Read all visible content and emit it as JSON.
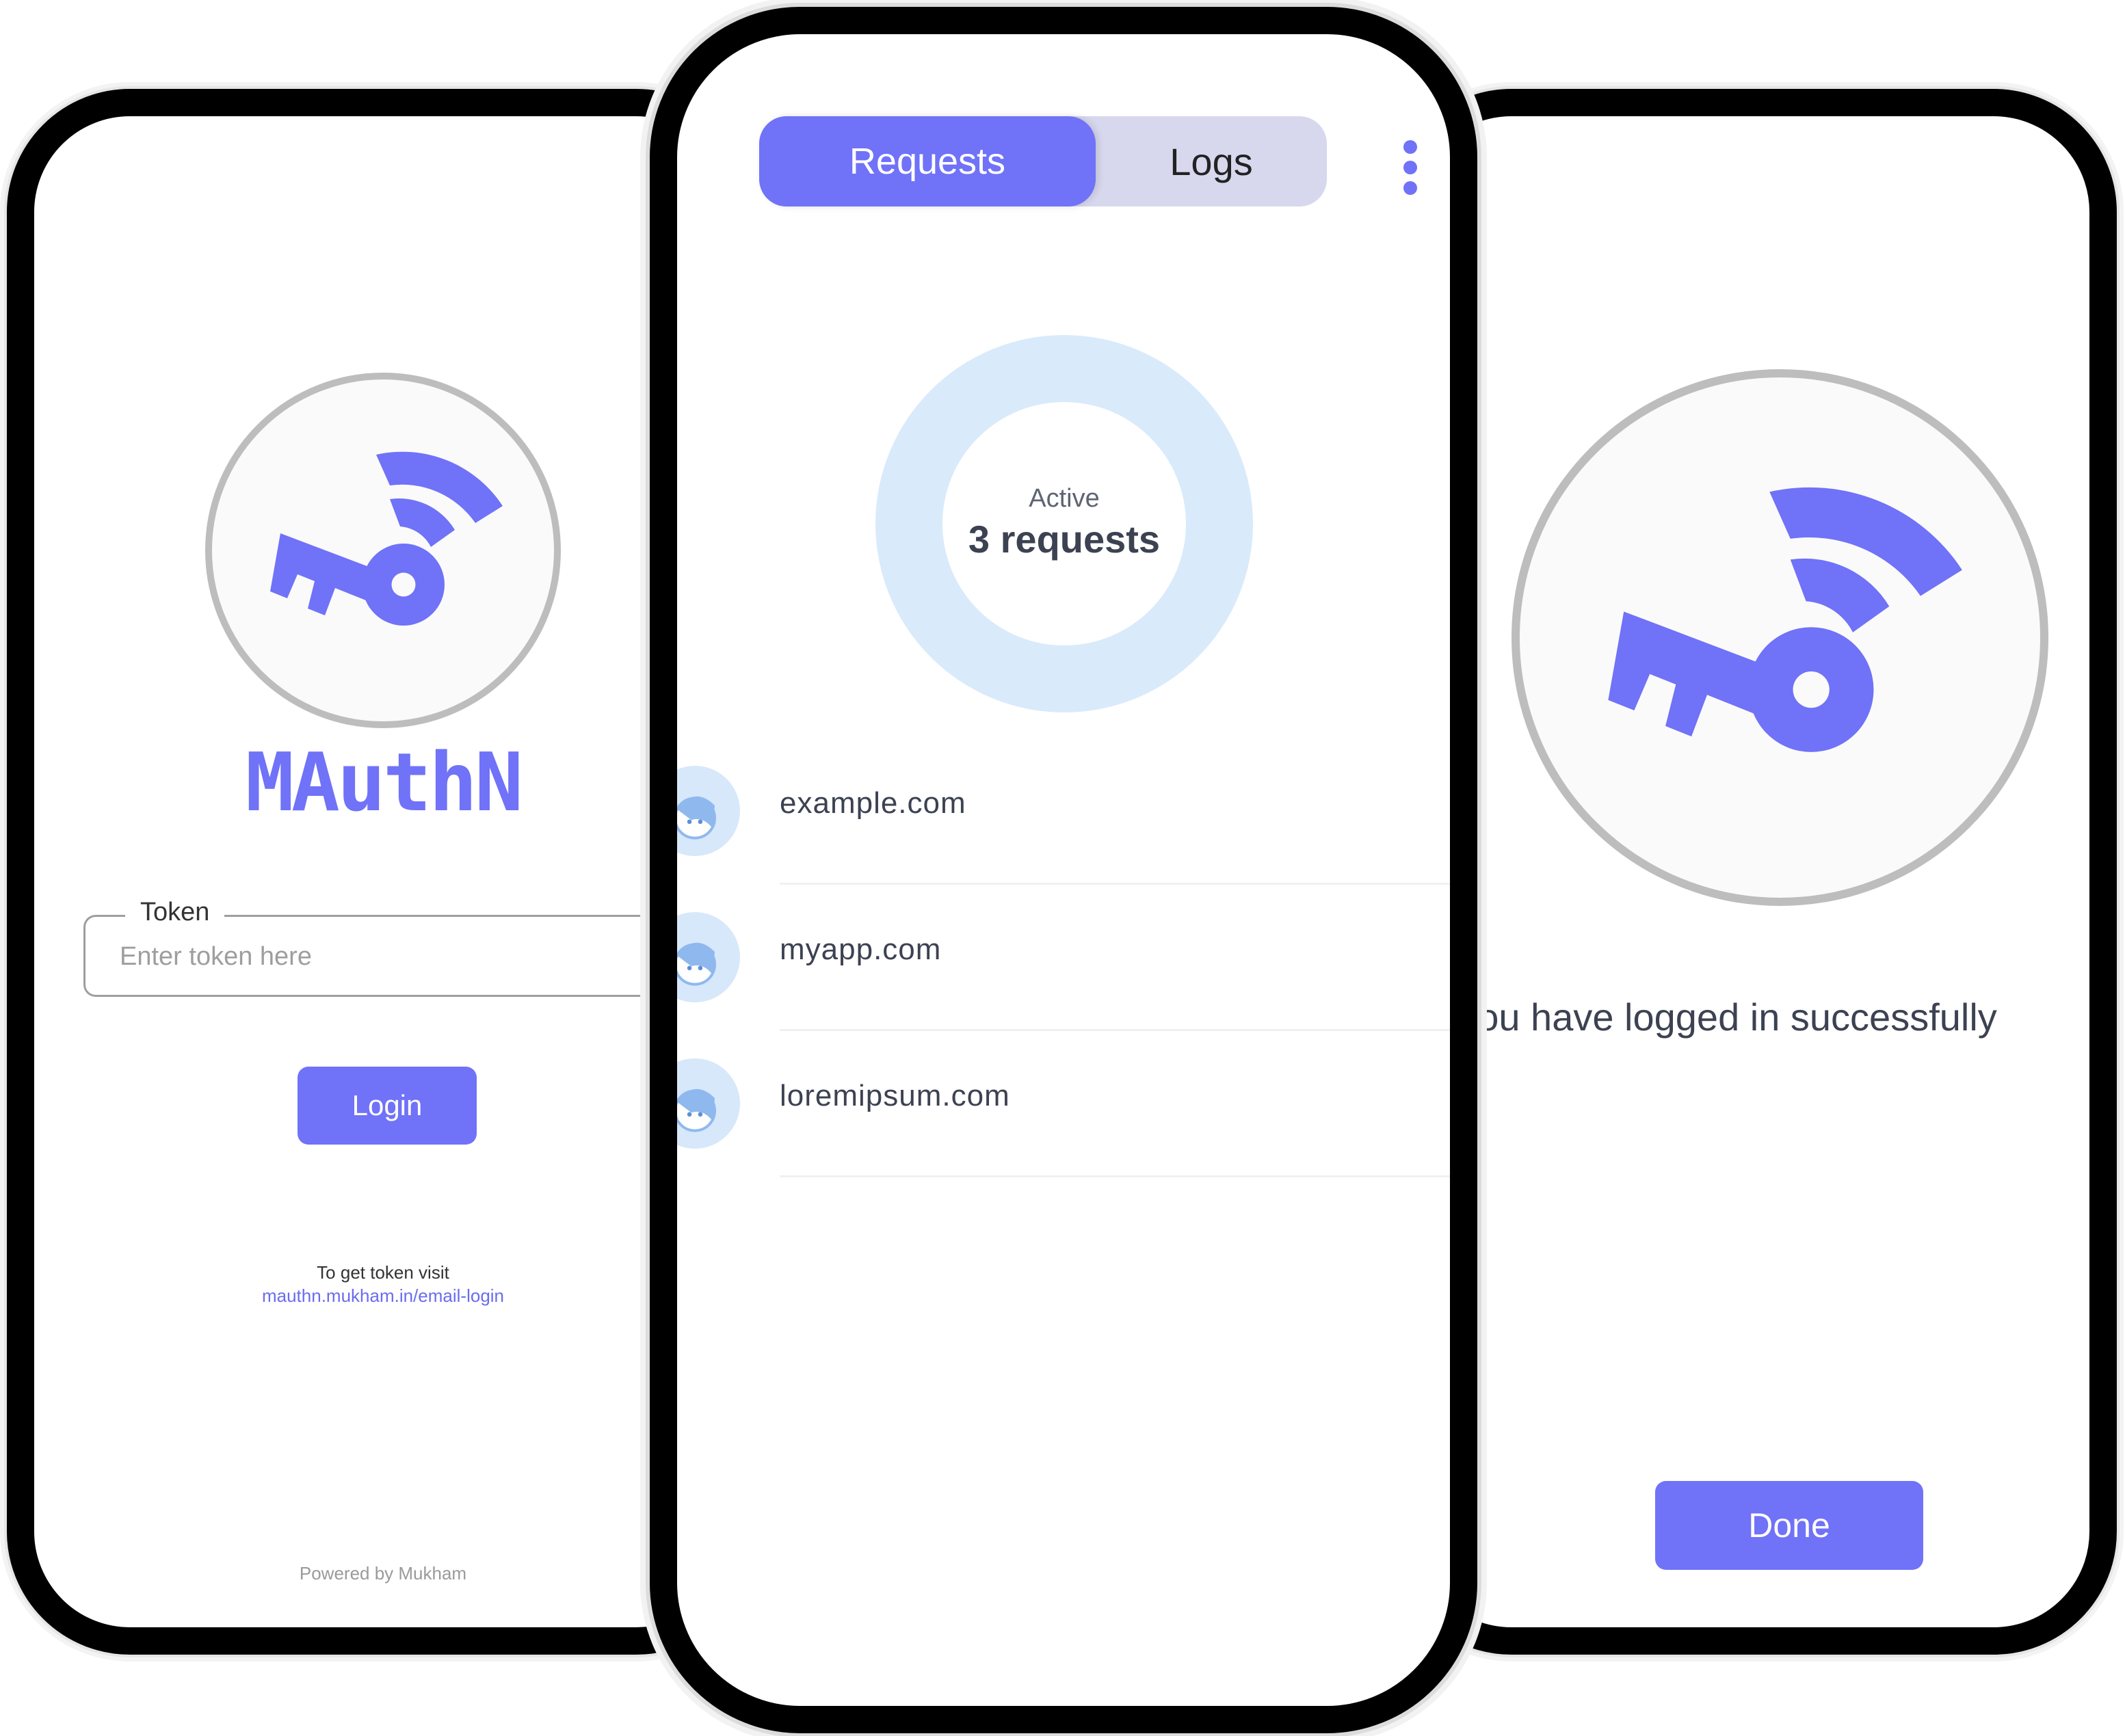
{
  "colors": {
    "accent": "#7072f8",
    "tab_inactive_bg": "#d7d8ee",
    "donut_ring": "#d9eafb",
    "text_dark": "#3c4252",
    "logo_ring": "#bdbdbd"
  },
  "login_screen": {
    "logo_icon": "key-wifi-icon",
    "brand_name": "MAuthN",
    "token_label": "Token",
    "token_placeholder": "Enter token here",
    "token_value": "",
    "login_button": "Login",
    "token_hint": "To get token visit",
    "token_link": "mauthn.mukham.in/email-login",
    "powered_by": "Powered by Mukham"
  },
  "requests_screen": {
    "tabs": [
      {
        "label": "Requests",
        "active": true
      },
      {
        "label": "Logs",
        "active": false
      }
    ],
    "menu_icon": "more-vertical-icon",
    "summary": {
      "label": "Active",
      "value": "3 requests"
    },
    "requests": [
      {
        "domain": "example.com",
        "icon": "user-avatar-icon"
      },
      {
        "domain": "myapp.com",
        "icon": "user-avatar-icon"
      },
      {
        "domain": "loremipsum.com",
        "icon": "user-avatar-icon"
      }
    ]
  },
  "success_screen": {
    "logo_icon": "key-wifi-icon",
    "message": "ou have logged in successfully",
    "done_button": "Done"
  }
}
